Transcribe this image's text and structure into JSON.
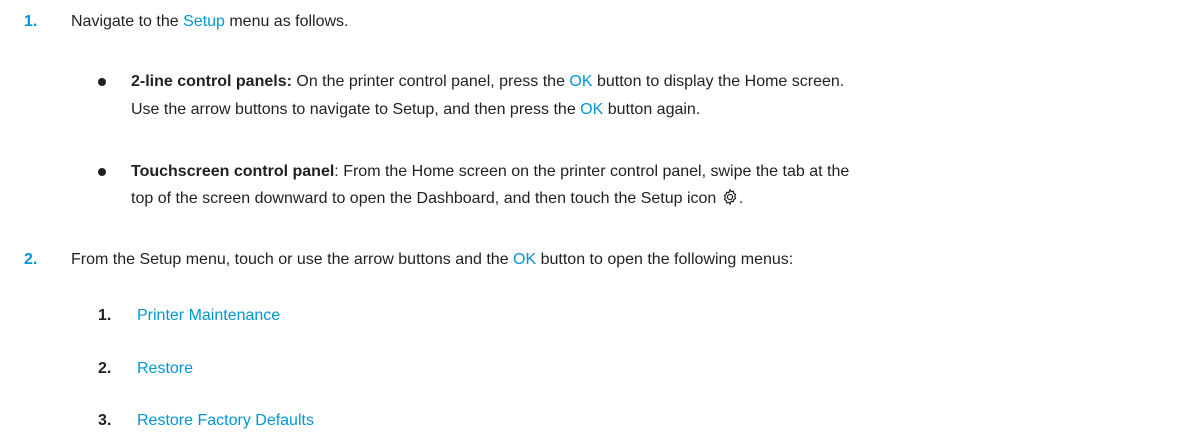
{
  "steps": [
    {
      "number": "1.",
      "text_before": "Navigate to the ",
      "link": "Setup",
      "text_after": " menu as follows."
    },
    {
      "number": "2.",
      "text_before": "From the Setup menu, touch or use the arrow buttons and the ",
      "link": "OK",
      "text_after": " button to open the following menus:"
    }
  ],
  "bullets": [
    {
      "label": "2-line control panels:",
      "line1_a": " On the printer control panel, press the ",
      "line1_ok": "OK",
      "line1_b": " button to display the Home screen.",
      "line2_a": "Use the arrow buttons to navigate to Setup, and then press the ",
      "line2_ok": "OK",
      "line2_b": " button again."
    },
    {
      "label": "Touchscreen control panel",
      "line1_a": ": From the Home screen on the printer control panel, swipe the tab at the",
      "line2_a": "top of the screen downward to open the Dashboard, and then touch the Setup icon ",
      "line2_b": "."
    }
  ],
  "menus": [
    {
      "number": "1.",
      "label": "Printer Maintenance"
    },
    {
      "number": "2.",
      "label": "Restore"
    },
    {
      "number": "3.",
      "label": "Restore Factory Defaults"
    }
  ],
  "icons": {
    "setup": "gear-icon"
  },
  "colors": {
    "link": "#0096d6",
    "text": "#231f20"
  }
}
